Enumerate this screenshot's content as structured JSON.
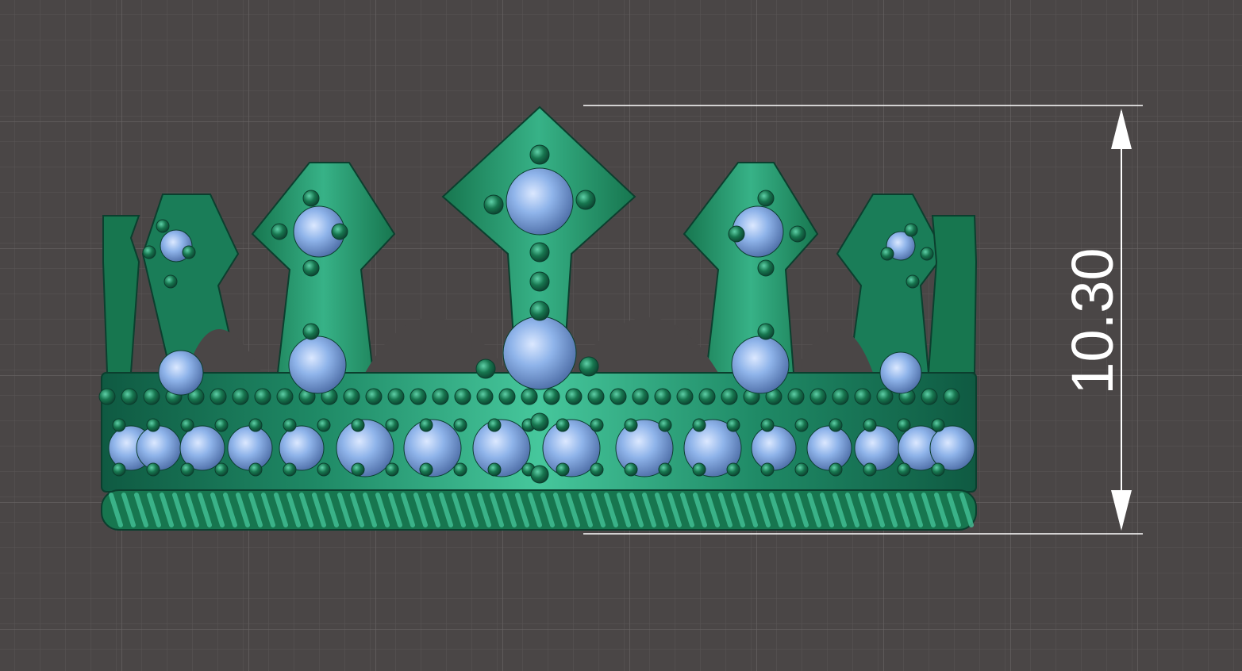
{
  "viewport": {
    "background": "#4a4646",
    "grid_minor_color": "#5a5656",
    "grid_major_color": "#6a6666"
  },
  "model": {
    "body_color": "#1f8a66",
    "body_highlight": "#46c79c",
    "body_shadow": "#0f5a42",
    "gem_color": "#8fb4ea",
    "gem_highlight": "#dbe8ff",
    "bead_color": "#17764f"
  },
  "dimension": {
    "value": "10.30",
    "line_color": "#ffffff"
  }
}
